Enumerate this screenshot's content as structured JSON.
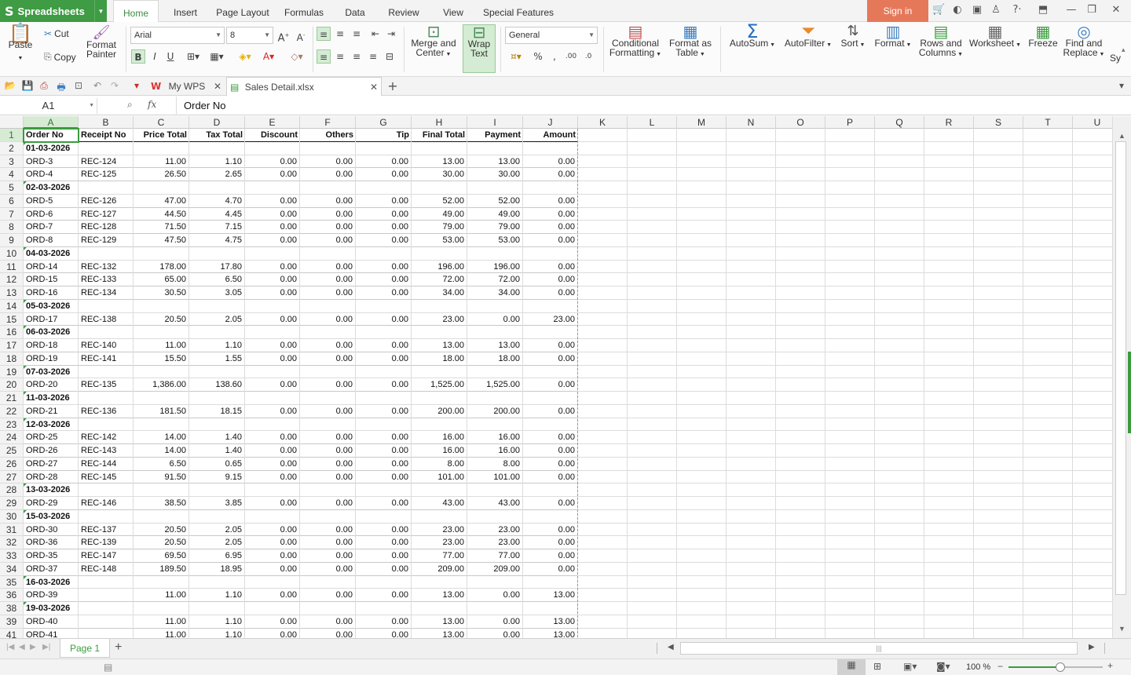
{
  "app": {
    "name": "Spreadsheets"
  },
  "menu_tabs": [
    "Home",
    "Insert",
    "Page Layout",
    "Formulas",
    "Data",
    "Review",
    "View",
    "Special Features"
  ],
  "sign_in": "Sign in",
  "clipboard": {
    "paste": "Paste",
    "cut": "Cut",
    "copy": "Copy",
    "format_painter_1": "Format",
    "format_painter_2": "Painter"
  },
  "font": {
    "name": "Arial",
    "size": "8"
  },
  "number_format": "General",
  "ribbon": {
    "merge_1": "Merge and",
    "merge_2": "Center",
    "wrap_1": "Wrap",
    "wrap_2": "Text",
    "cond_1": "Conditional",
    "cond_2": "Formatting",
    "fat_1": "Format as",
    "fat_2": "Table",
    "autosum": "AutoSum",
    "autofilter": "AutoFilter",
    "sort": "Sort",
    "format": "Format",
    "rows_1": "Rows and",
    "rows_2": "Columns",
    "worksheet": "Worksheet",
    "freeze": "Freeze",
    "find_1": "Find and",
    "find_2": "Replace",
    "sy": "Sy"
  },
  "doc_tabs": {
    "mywps": "My WPS",
    "file": "Sales Detail.xlsx"
  },
  "formula_bar": {
    "cell": "A1",
    "fx": "fx",
    "content": "Order No"
  },
  "columns": [
    "A",
    "B",
    "C",
    "D",
    "E",
    "F",
    "G",
    "H",
    "I",
    "J",
    "K",
    "L",
    "M",
    "N",
    "O",
    "P",
    "Q",
    "R",
    "S",
    "T",
    "U"
  ],
  "headers": [
    "Order No",
    "Receipt No",
    "Price Total",
    "Tax Total",
    "Discount",
    "Others",
    "Tip",
    "Final Total",
    "Payment",
    "Amount"
  ],
  "rows": [
    {
      "n": "2",
      "date": "01-03-2026"
    },
    {
      "n": "3",
      "v": [
        "ORD-3",
        "REC-124",
        "11.00",
        "1.10",
        "0.00",
        "0.00",
        "0.00",
        "13.00",
        "13.00",
        "0.00"
      ]
    },
    {
      "n": "4",
      "v": [
        "ORD-4",
        "REC-125",
        "26.50",
        "2.65",
        "0.00",
        "0.00",
        "0.00",
        "30.00",
        "30.00",
        "0.00"
      ]
    },
    {
      "n": "5",
      "date": "02-03-2026"
    },
    {
      "n": "6",
      "v": [
        "ORD-5",
        "REC-126",
        "47.00",
        "4.70",
        "0.00",
        "0.00",
        "0.00",
        "52.00",
        "52.00",
        "0.00"
      ]
    },
    {
      "n": "7",
      "v": [
        "ORD-6",
        "REC-127",
        "44.50",
        "4.45",
        "0.00",
        "0.00",
        "0.00",
        "49.00",
        "49.00",
        "0.00"
      ]
    },
    {
      "n": "8",
      "v": [
        "ORD-7",
        "REC-128",
        "71.50",
        "7.15",
        "0.00",
        "0.00",
        "0.00",
        "79.00",
        "79.00",
        "0.00"
      ]
    },
    {
      "n": "9",
      "v": [
        "ORD-8",
        "REC-129",
        "47.50",
        "4.75",
        "0.00",
        "0.00",
        "0.00",
        "53.00",
        "53.00",
        "0.00"
      ]
    },
    {
      "n": "10",
      "date": "04-03-2026"
    },
    {
      "n": "11",
      "v": [
        "ORD-14",
        "REC-132",
        "178.00",
        "17.80",
        "0.00",
        "0.00",
        "0.00",
        "196.00",
        "196.00",
        "0.00"
      ]
    },
    {
      "n": "12",
      "v": [
        "ORD-15",
        "REC-133",
        "65.00",
        "6.50",
        "0.00",
        "0.00",
        "0.00",
        "72.00",
        "72.00",
        "0.00"
      ]
    },
    {
      "n": "13",
      "v": [
        "ORD-16",
        "REC-134",
        "30.50",
        "3.05",
        "0.00",
        "0.00",
        "0.00",
        "34.00",
        "34.00",
        "0.00"
      ]
    },
    {
      "n": "14",
      "date": "05-03-2026"
    },
    {
      "n": "15",
      "v": [
        "ORD-17",
        "REC-138",
        "20.50",
        "2.05",
        "0.00",
        "0.00",
        "0.00",
        "23.00",
        "0.00",
        "23.00"
      ]
    },
    {
      "n": "16",
      "date": "06-03-2026"
    },
    {
      "n": "17",
      "v": [
        "ORD-18",
        "REC-140",
        "11.00",
        "1.10",
        "0.00",
        "0.00",
        "0.00",
        "13.00",
        "13.00",
        "0.00"
      ]
    },
    {
      "n": "18",
      "v": [
        "ORD-19",
        "REC-141",
        "15.50",
        "1.55",
        "0.00",
        "0.00",
        "0.00",
        "18.00",
        "18.00",
        "0.00"
      ]
    },
    {
      "n": "19",
      "date": "07-03-2026"
    },
    {
      "n": "20",
      "v": [
        "ORD-20",
        "REC-135",
        "1,386.00",
        "138.60",
        "0.00",
        "0.00",
        "0.00",
        "1,525.00",
        "1,525.00",
        "0.00"
      ]
    },
    {
      "n": "21",
      "date": "11-03-2026"
    },
    {
      "n": "22",
      "v": [
        "ORD-21",
        "REC-136",
        "181.50",
        "18.15",
        "0.00",
        "0.00",
        "0.00",
        "200.00",
        "200.00",
        "0.00"
      ]
    },
    {
      "n": "23",
      "date": "12-03-2026"
    },
    {
      "n": "24",
      "v": [
        "ORD-25",
        "REC-142",
        "14.00",
        "1.40",
        "0.00",
        "0.00",
        "0.00",
        "16.00",
        "16.00",
        "0.00"
      ]
    },
    {
      "n": "25",
      "v": [
        "ORD-26",
        "REC-143",
        "14.00",
        "1.40",
        "0.00",
        "0.00",
        "0.00",
        "16.00",
        "16.00",
        "0.00"
      ]
    },
    {
      "n": "26",
      "v": [
        "ORD-27",
        "REC-144",
        "6.50",
        "0.65",
        "0.00",
        "0.00",
        "0.00",
        "8.00",
        "8.00",
        "0.00"
      ]
    },
    {
      "n": "27",
      "v": [
        "ORD-28",
        "REC-145",
        "91.50",
        "9.15",
        "0.00",
        "0.00",
        "0.00",
        "101.00",
        "101.00",
        "0.00"
      ]
    },
    {
      "n": "28",
      "date": "13-03-2026"
    },
    {
      "n": "29",
      "v": [
        "ORD-29",
        "REC-146",
        "38.50",
        "3.85",
        "0.00",
        "0.00",
        "0.00",
        "43.00",
        "43.00",
        "0.00"
      ]
    },
    {
      "n": "30",
      "date": "15-03-2026"
    },
    {
      "n": "31",
      "v": [
        "ORD-30",
        "REC-137",
        "20.50",
        "2.05",
        "0.00",
        "0.00",
        "0.00",
        "23.00",
        "23.00",
        "0.00"
      ]
    },
    {
      "n": "32",
      "v": [
        "ORD-36",
        "REC-139",
        "20.50",
        "2.05",
        "0.00",
        "0.00",
        "0.00",
        "23.00",
        "23.00",
        "0.00"
      ]
    },
    {
      "n": "33",
      "v": [
        "ORD-35",
        "REC-147",
        "69.50",
        "6.95",
        "0.00",
        "0.00",
        "0.00",
        "77.00",
        "77.00",
        "0.00"
      ]
    },
    {
      "n": "34",
      "v": [
        "ORD-37",
        "REC-148",
        "189.50",
        "18.95",
        "0.00",
        "0.00",
        "0.00",
        "209.00",
        "209.00",
        "0.00"
      ]
    },
    {
      "n": "35",
      "date": "16-03-2026"
    },
    {
      "n": "36",
      "v": [
        "ORD-39",
        "",
        "11.00",
        "1.10",
        "0.00",
        "0.00",
        "0.00",
        "13.00",
        "0.00",
        "13.00"
      ]
    },
    {
      "n": "38",
      "date": "19-03-2026"
    },
    {
      "n": "39",
      "v": [
        "ORD-40",
        "",
        "11.00",
        "1.10",
        "0.00",
        "0.00",
        "0.00",
        "13.00",
        "0.00",
        "13.00"
      ]
    },
    {
      "n": "41",
      "v": [
        "ORD-41",
        "",
        "11.00",
        "1.10",
        "0.00",
        "0.00",
        "0.00",
        "13.00",
        "0.00",
        "13.00"
      ]
    }
  ],
  "sheet_tab": "Page 1",
  "zoom": "100 %"
}
